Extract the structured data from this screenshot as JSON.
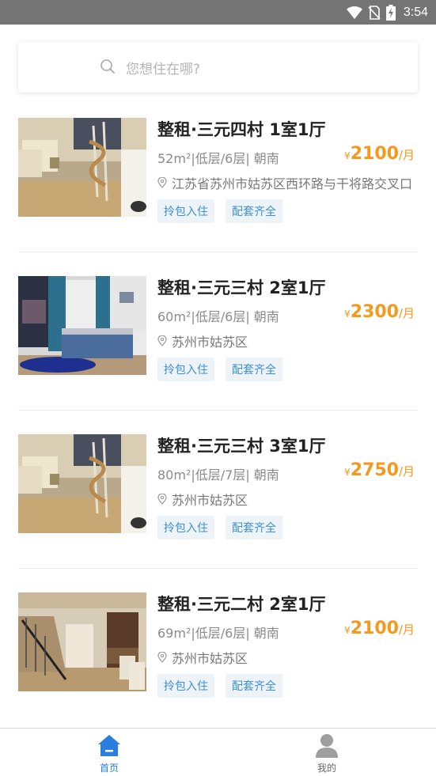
{
  "status_bar": {
    "time": "3:54",
    "icons": [
      "wifi-icon",
      "no-sim-icon",
      "battery-charging-icon"
    ]
  },
  "search": {
    "placeholder": "您想住在哪?",
    "icon": "search-icon"
  },
  "listings": [
    {
      "title": "整租·三元四村 1室1厅",
      "meta": "52m²|低层/6层| 朝南",
      "price_symbol": "¥",
      "price": "2100",
      "price_unit": "/月",
      "address": "江苏省苏州市姑苏区西环路与干将路交叉口",
      "tags": [
        "拎包入住",
        "配套齐全"
      ],
      "photo": "loft-living-room-spiral-stairs"
    },
    {
      "title": "整租·三元三村 2室1厅",
      "meta": "60m²|低层/6层| 朝南",
      "price_symbol": "¥",
      "price": "2300",
      "price_unit": "/月",
      "address": "苏州市姑苏区",
      "tags": [
        "拎包入住",
        "配套齐全"
      ],
      "photo": "bedroom-blue-curtains"
    },
    {
      "title": "整租·三元三村 3室1厅",
      "meta": "80m²|低层/7层| 朝南",
      "price_symbol": "¥",
      "price": "2750",
      "price_unit": "/月",
      "address": "苏州市姑苏区",
      "tags": [
        "拎包入住",
        "配套齐全"
      ],
      "photo": "loft-living-room-spiral-stairs"
    },
    {
      "title": "整租·三元二村 2室1厅",
      "meta": "69m²|低层/6层| 朝南",
      "price_symbol": "¥",
      "price": "2100",
      "price_unit": "/月",
      "address": "苏州市姑苏区",
      "tags": [
        "拎包入住",
        "配套齐全"
      ],
      "photo": "loft-stairs-dining"
    }
  ],
  "tabbar": [
    {
      "label": "首页",
      "icon": "home-icon",
      "active": true
    },
    {
      "label": "我的",
      "icon": "user-icon",
      "active": false
    }
  ],
  "colors": {
    "accent": "#2a7de1",
    "price": "#f39a1d",
    "tag_text": "#3d8fd4",
    "tag_bg": "#eef3f8",
    "status_bar": "#757575"
  }
}
